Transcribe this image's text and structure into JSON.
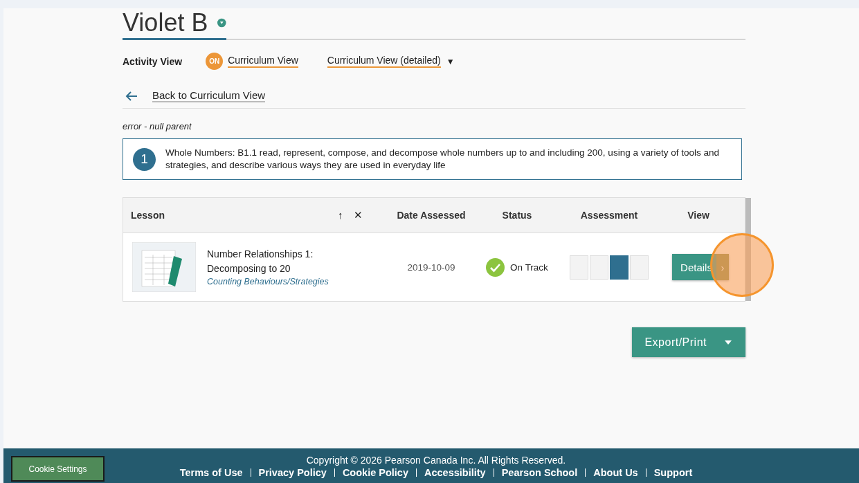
{
  "student": {
    "name": "Violet B"
  },
  "view_switch": {
    "label": "Activity View",
    "on_label": "ON",
    "current": "Curriculum View",
    "dropdown": "Curriculum View (detailed)",
    "dropdown_caret": "▼"
  },
  "back_link": "Back to Curriculum View",
  "error_text": "error - null parent",
  "outcome": {
    "number": "1",
    "text": "Whole Numbers: B1.1 read, represent, compose, and decompose whole numbers up to and including 200, using a variety of tools and strategies, and describe various ways they are used in everyday life"
  },
  "table": {
    "columns": [
      "Lesson",
      "Date Assessed",
      "Status",
      "Assessment",
      "View"
    ],
    "sort_icons": [
      "↑",
      "✕"
    ],
    "rows": [
      {
        "title": "Number Relationships 1: Decomposing to 20",
        "subtitle": "Counting Behaviours/Strategies",
        "date": "2019-10-09",
        "status": "On Track",
        "assessment": [
          {
            "selected": false
          },
          {
            "selected": false
          },
          {
            "selected": true
          },
          {
            "selected": false
          }
        ],
        "button": "Details",
        "button_chevron": "›"
      }
    ]
  },
  "export_button": "Export/Print",
  "footer": {
    "cookie_button": "Cookie Settings",
    "copyright": "Copyright © 2026 Pearson Canada Inc. All Rights Reserved.",
    "links": [
      "Terms of Use",
      "Privacy Policy",
      "Cookie Policy",
      "Accessibility",
      "Pearson School",
      "About Us",
      "Support"
    ]
  }
}
